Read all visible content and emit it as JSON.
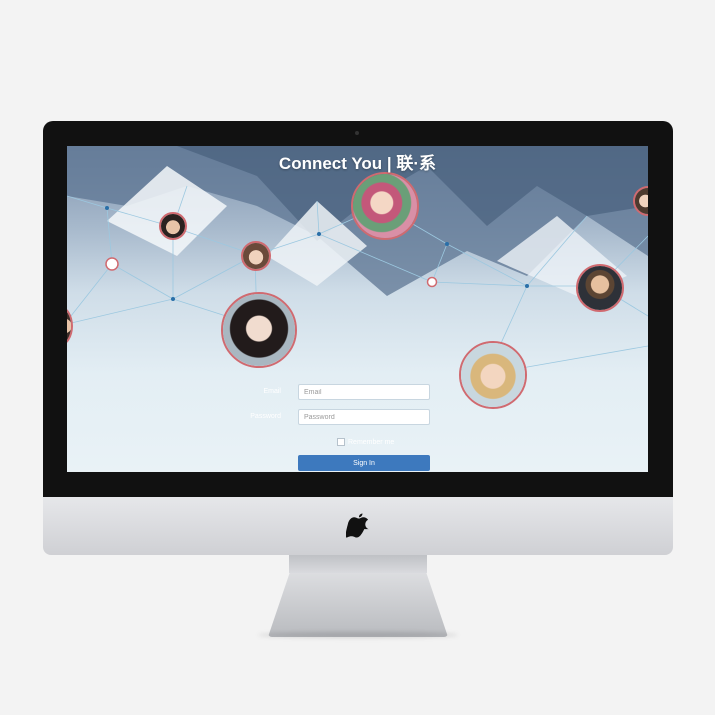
{
  "app": {
    "title": "Connect You | 联·系"
  },
  "login_form": {
    "email_label": "Email",
    "email_placeholder": "Email",
    "email_value": "",
    "password_label": "Password",
    "password_placeholder": "Password",
    "password_value": "",
    "remember_label": "Remember me",
    "remember_checked": false,
    "signin_label": "Sign In"
  },
  "device": {
    "logo_icon": "apple-logo-icon"
  },
  "colors": {
    "accent": "#3d79be",
    "avatar_ring": "#d06a70",
    "node_dot": "#2a6fa8",
    "network_line": "#9cc8e0"
  }
}
